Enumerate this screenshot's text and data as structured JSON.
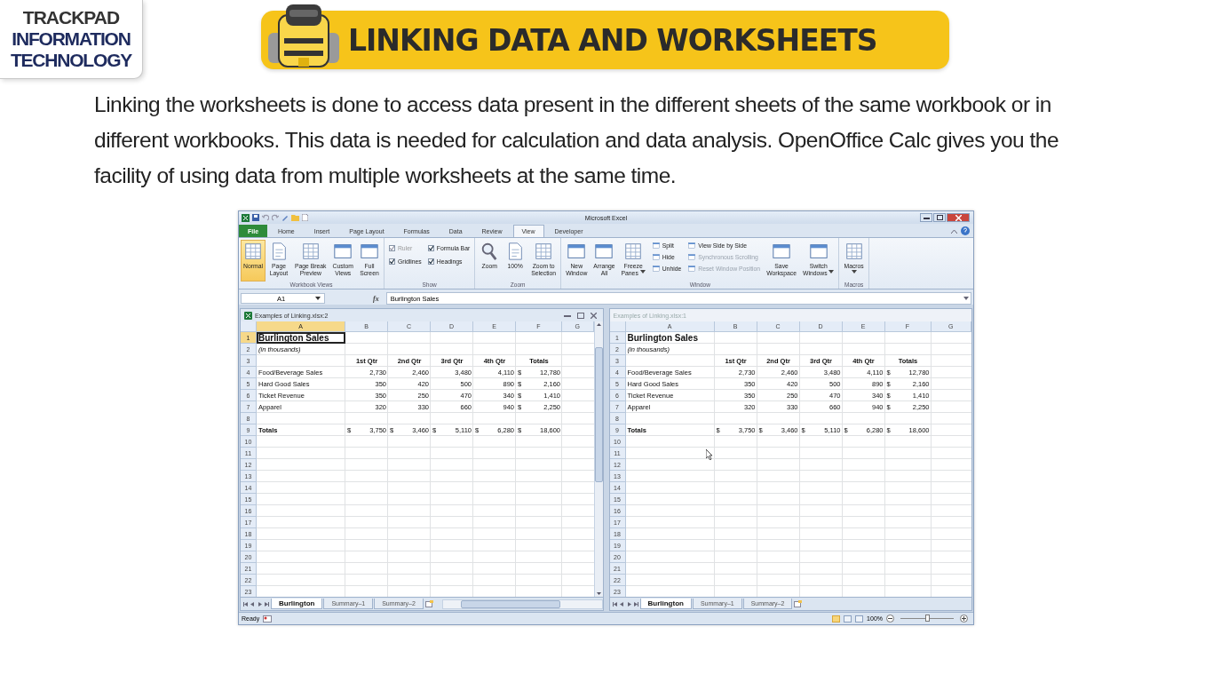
{
  "logo": {
    "lines": [
      "TRACKPAD",
      "INFORMATION",
      "TECHNOLOGY"
    ]
  },
  "banner": {
    "title": "LINKING DATA AND WORKSHEETS"
  },
  "paragraph": "Linking the worksheets is done to access data present in the different sheets of the same workbook or in different workbooks. This data is needed for calculation and data analysis. OpenOffice Calc gives you the facility of using data from multiple worksheets at the same time.",
  "excel": {
    "title": "Microsoft Excel",
    "tabs": [
      {
        "label": "File",
        "kind": "file",
        "selected": false
      },
      {
        "label": "Home",
        "kind": "tab",
        "selected": false
      },
      {
        "label": "Insert",
        "kind": "tab",
        "selected": false
      },
      {
        "label": "Page Layout",
        "kind": "tab",
        "selected": false
      },
      {
        "label": "Formulas",
        "kind": "tab",
        "selected": false
      },
      {
        "label": "Data",
        "kind": "tab",
        "selected": false
      },
      {
        "label": "Review",
        "kind": "tab",
        "selected": false
      },
      {
        "label": "View",
        "kind": "tab",
        "selected": true
      },
      {
        "label": "Developer",
        "kind": "tab",
        "selected": false
      }
    ],
    "ribbon": {
      "groups": [
        {
          "name": "Workbook Views",
          "items": [
            {
              "kind": "large",
              "lines": [
                "Normal"
              ],
              "selected": true
            },
            {
              "kind": "large",
              "lines": [
                "Page",
                "Layout"
              ],
              "selected": false
            },
            {
              "kind": "large",
              "lines": [
                "Page Break",
                "Preview"
              ],
              "selected": false
            },
            {
              "kind": "large",
              "lines": [
                "Custom",
                "Views"
              ],
              "selected": false
            },
            {
              "kind": "large",
              "lines": [
                "Full",
                "Screen"
              ],
              "selected": false
            }
          ]
        },
        {
          "name": "Show",
          "items": [
            {
              "kind": "stack",
              "items": [
                {
                  "kind": "check",
                  "label": "Ruler",
                  "checked": true,
                  "disabled": true
                },
                {
                  "kind": "check",
                  "label": "Gridlines",
                  "checked": true,
                  "disabled": false
                }
              ]
            },
            {
              "kind": "stack",
              "items": [
                {
                  "kind": "check",
                  "label": "Formula Bar",
                  "checked": true,
                  "disabled": false
                },
                {
                  "kind": "check",
                  "label": "Headings",
                  "checked": true,
                  "disabled": false
                }
              ]
            }
          ]
        },
        {
          "name": "Zoom",
          "items": [
            {
              "kind": "large",
              "lines": [
                "Zoom"
              ],
              "selected": false
            },
            {
              "kind": "large",
              "lines": [
                "100%"
              ],
              "selected": false
            },
            {
              "kind": "large",
              "lines": [
                "Zoom to",
                "Selection"
              ],
              "selected": false
            }
          ]
        },
        {
          "name": "Window",
          "items": [
            {
              "kind": "large",
              "lines": [
                "New",
                "Window"
              ],
              "selected": false
            },
            {
              "kind": "large",
              "lines": [
                "Arrange",
                "All"
              ],
              "selected": false
            },
            {
              "kind": "large",
              "lines": [
                "Freeze",
                "Panes"
              ],
              "selected": false,
              "dropdown": true
            },
            {
              "kind": "stack",
              "items": [
                {
                  "kind": "small",
                  "label": "Split",
                  "disabled": false
                },
                {
                  "kind": "small",
                  "label": "Hide",
                  "disabled": false
                },
                {
                  "kind": "small",
                  "label": "Unhide",
                  "disabled": false
                }
              ]
            },
            {
              "kind": "stack",
              "items": [
                {
                  "kind": "small",
                  "label": "View Side by Side",
                  "disabled": false
                },
                {
                  "kind": "small",
                  "label": "Synchronous Scrolling",
                  "disabled": true
                },
                {
                  "kind": "small",
                  "label": "Reset Window Position",
                  "disabled": true
                }
              ]
            },
            {
              "kind": "large",
              "lines": [
                "Save",
                "Workspace"
              ],
              "selected": false
            },
            {
              "kind": "large",
              "lines": [
                "Switch",
                "Windows"
              ],
              "selected": false,
              "dropdown": true
            }
          ]
        },
        {
          "name": "Macros",
          "items": [
            {
              "kind": "large",
              "lines": [
                "Macros"
              ],
              "selected": false,
              "dropdown": true
            }
          ]
        }
      ]
    },
    "name_box": "A1",
    "function_label": "fx",
    "formula": "Burlington Sales",
    "windows": [
      {
        "title": "Examples of Linking.xlsx:2",
        "active": true,
        "columns": [
          "A",
          "B",
          "C",
          "D",
          "E",
          "F",
          "G"
        ],
        "rows": [
          {
            "number": "1",
            "kind": "title",
            "cells": [
              "Burlington Sales"
            ]
          },
          {
            "number": "2",
            "kind": "note",
            "cells": [
              "(in thousands)"
            ]
          },
          {
            "number": "3",
            "kind": "header",
            "cells": [
              null,
              "1st Qtr",
              "2nd Qtr",
              "3rd Qtr",
              "4th Qtr",
              "Totals"
            ]
          },
          {
            "number": "4",
            "kind": "data",
            "cells": [
              "Food/Beverage Sales",
              "2,730",
              "2,460",
              "3,480",
              "4,110",
              {
                "currency": "$",
                "amount": "12,780"
              }
            ]
          },
          {
            "number": "5",
            "kind": "data",
            "cells": [
              "Hard Good Sales",
              "350",
              "420",
              "500",
              "890",
              {
                "currency": "$",
                "amount": "2,160"
              }
            ]
          },
          {
            "number": "6",
            "kind": "data",
            "cells": [
              "Ticket Revenue",
              "350",
              "250",
              "470",
              "340",
              {
                "currency": "$",
                "amount": "1,410"
              }
            ]
          },
          {
            "number": "7",
            "kind": "data",
            "cells": [
              "Apparel",
              "320",
              "330",
              "660",
              "940",
              {
                "currency": "$",
                "amount": "2,250"
              }
            ]
          },
          {
            "number": "8"
          },
          {
            "number": "9",
            "kind": "total",
            "cells": [
              "Totals",
              {
                "currency": "$",
                "amount": "3,750"
              },
              {
                "currency": "$",
                "amount": "3,460"
              },
              {
                "currency": "$",
                "amount": "5,110"
              },
              {
                "currency": "$",
                "amount": "6,280"
              },
              {
                "currency": "$",
                "amount": "18,600"
              }
            ]
          },
          {
            "number": "10"
          },
          {
            "number": "11"
          },
          {
            "number": "12"
          },
          {
            "number": "13"
          },
          {
            "number": "14"
          },
          {
            "number": "15"
          },
          {
            "number": "16"
          },
          {
            "number": "17"
          },
          {
            "number": "18"
          },
          {
            "number": "19"
          },
          {
            "number": "20"
          },
          {
            "number": "21"
          },
          {
            "number": "22"
          },
          {
            "number": "23"
          }
        ],
        "sheet_tabs": [
          {
            "label": "Burlington",
            "selected": true
          },
          {
            "label": "Summary–1",
            "selected": false
          },
          {
            "label": "Summary–2",
            "selected": false
          }
        ]
      },
      {
        "title": "Examples of Linking.xlsx:1",
        "active": false,
        "columns": [
          "A",
          "B",
          "C",
          "D",
          "E",
          "F",
          "G"
        ],
        "rows": [
          {
            "number": "1",
            "kind": "title",
            "cells": [
              "Burlington Sales"
            ]
          },
          {
            "number": "2",
            "kind": "note",
            "cells": [
              "(in thousands)"
            ]
          },
          {
            "number": "3",
            "kind": "header",
            "cells": [
              null,
              "1st Qtr",
              "2nd Qtr",
              "3rd Qtr",
              "4th Qtr",
              "Totals"
            ]
          },
          {
            "number": "4",
            "kind": "data",
            "cells": [
              "Food/Beverage Sales",
              "2,730",
              "2,460",
              "3,480",
              "4,110",
              {
                "currency": "$",
                "amount": "12,780"
              }
            ]
          },
          {
            "number": "5",
            "kind": "data",
            "cells": [
              "Hard Good Sales",
              "350",
              "420",
              "500",
              "890",
              {
                "currency": "$",
                "amount": "2,160"
              }
            ]
          },
          {
            "number": "6",
            "kind": "data",
            "cells": [
              "Ticket Revenue",
              "350",
              "250",
              "470",
              "340",
              {
                "currency": "$",
                "amount": "1,410"
              }
            ]
          },
          {
            "number": "7",
            "kind": "data",
            "cells": [
              "Apparel",
              "320",
              "330",
              "660",
              "940",
              {
                "currency": "$",
                "amount": "2,250"
              }
            ]
          },
          {
            "number": "8"
          },
          {
            "number": "9",
            "kind": "total",
            "cells": [
              "Totals",
              {
                "currency": "$",
                "amount": "3,750"
              },
              {
                "currency": "$",
                "amount": "3,460"
              },
              {
                "currency": "$",
                "amount": "5,110"
              },
              {
                "currency": "$",
                "amount": "6,280"
              },
              {
                "currency": "$",
                "amount": "18,600"
              }
            ]
          },
          {
            "number": "10"
          },
          {
            "number": "11"
          },
          {
            "number": "12"
          },
          {
            "number": "13"
          },
          {
            "number": "14"
          },
          {
            "number": "15"
          },
          {
            "number": "16"
          },
          {
            "number": "17"
          },
          {
            "number": "18"
          },
          {
            "number": "19"
          },
          {
            "number": "20"
          },
          {
            "number": "21"
          },
          {
            "number": "22"
          },
          {
            "number": "23"
          }
        ],
        "sheet_tabs": [
          {
            "label": "Burlington",
            "selected": true
          },
          {
            "label": "Summary–1",
            "selected": false
          },
          {
            "label": "Summary–2",
            "selected": false
          }
        ]
      }
    ],
    "status_bar": {
      "text": "Ready",
      "view_buttons": [
        {
          "selected": true
        },
        {
          "selected": false
        },
        {
          "selected": false
        }
      ],
      "zoom": "100%",
      "zoom_slider": {
        "level": 0.5
      }
    }
  }
}
